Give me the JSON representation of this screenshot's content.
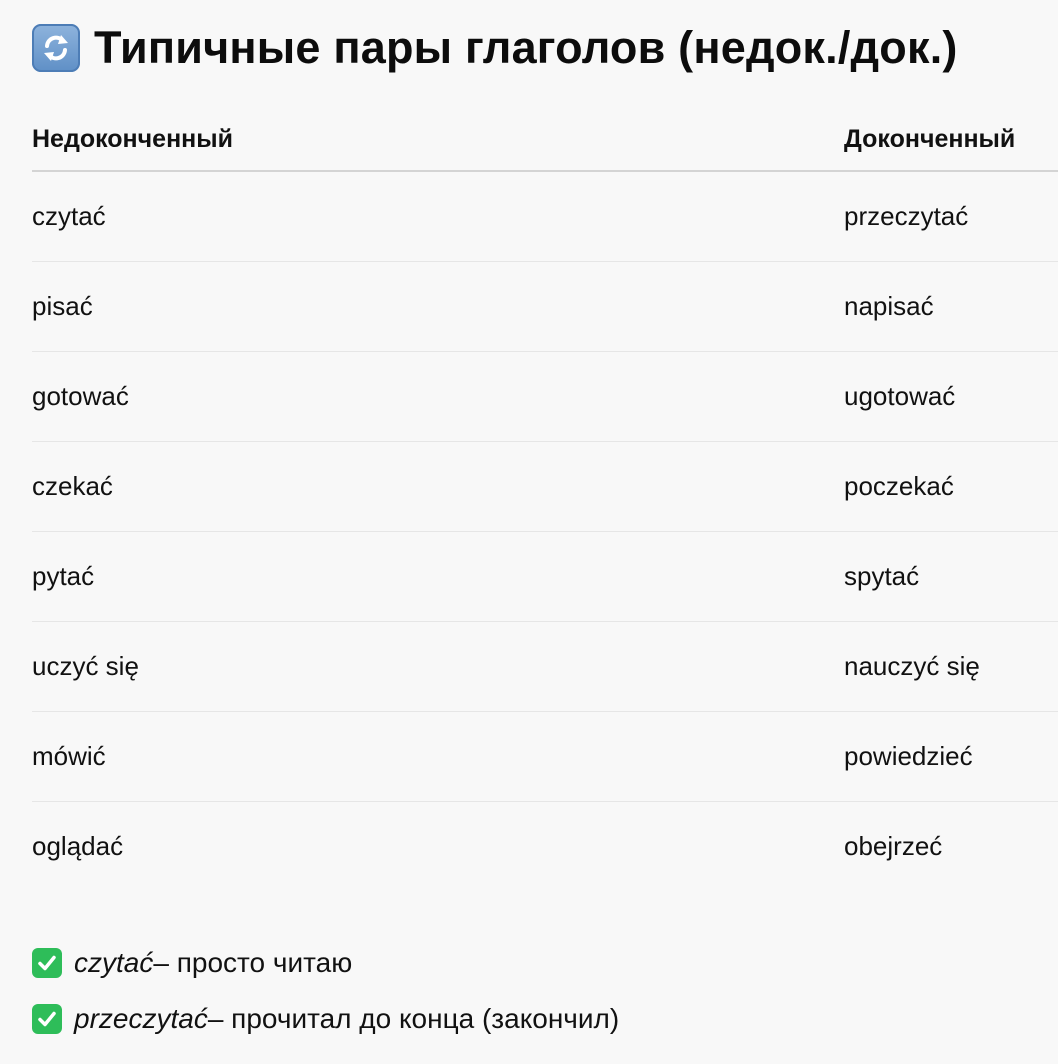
{
  "header": {
    "icon": "refresh-arrows-icon",
    "title": "Типичные пары глаголов (недок./док.)"
  },
  "table": {
    "columns": [
      "Недоконченный",
      "Доконченный"
    ],
    "rows": [
      [
        "czytać",
        "przeczytać"
      ],
      [
        "pisać",
        "napisać"
      ],
      [
        "gotować",
        "ugotować"
      ],
      [
        "czekać",
        "poczekać"
      ],
      [
        "pytać",
        "spytać"
      ],
      [
        "uczyć się",
        "nauczyć się"
      ],
      [
        "mówić",
        "powiedzieć"
      ],
      [
        "oglądać",
        "obejrzeć"
      ]
    ]
  },
  "notes": [
    {
      "icon": "check-mark-icon",
      "verb": "czytać",
      "text": " – просто читаю"
    },
    {
      "icon": "check-mark-icon",
      "verb": "przeczytać",
      "text": " – прочитал до конца (закончил)"
    }
  ],
  "colors": {
    "background": "#f8f8f8",
    "text": "#111111",
    "check": "#2ebd59",
    "icon": "#6f9bd0"
  }
}
